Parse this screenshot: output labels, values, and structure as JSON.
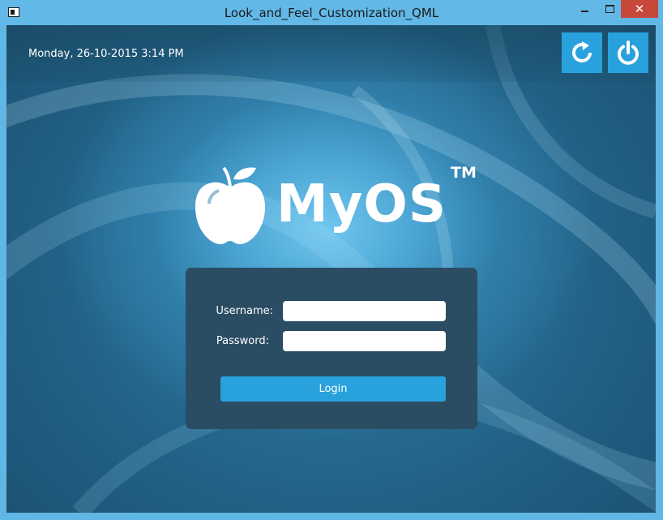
{
  "window": {
    "title": "Look_and_Feel_Customization_QML",
    "controls": {
      "minimize": "minimize",
      "maximize": "maximize",
      "close": "close"
    }
  },
  "header": {
    "datetime": "Monday, 26-10-2015 3:14 PM",
    "buttons": [
      {
        "icon": "refresh-icon",
        "color": "#28a1dd"
      },
      {
        "icon": "power-icon",
        "color": "#28a1dd"
      }
    ]
  },
  "brand": {
    "name": "MyOS",
    "trademark": "TM",
    "logo_icon": "apple-logo-icon"
  },
  "login": {
    "username_label": "Username:",
    "username_value": "",
    "password_label": "Password:",
    "password_value": "",
    "button_label": "Login"
  },
  "colors": {
    "accent": "#28a1dd",
    "panel": "#2a4d63",
    "titlebar": "#62b8e6",
    "close": "#c7473a"
  }
}
